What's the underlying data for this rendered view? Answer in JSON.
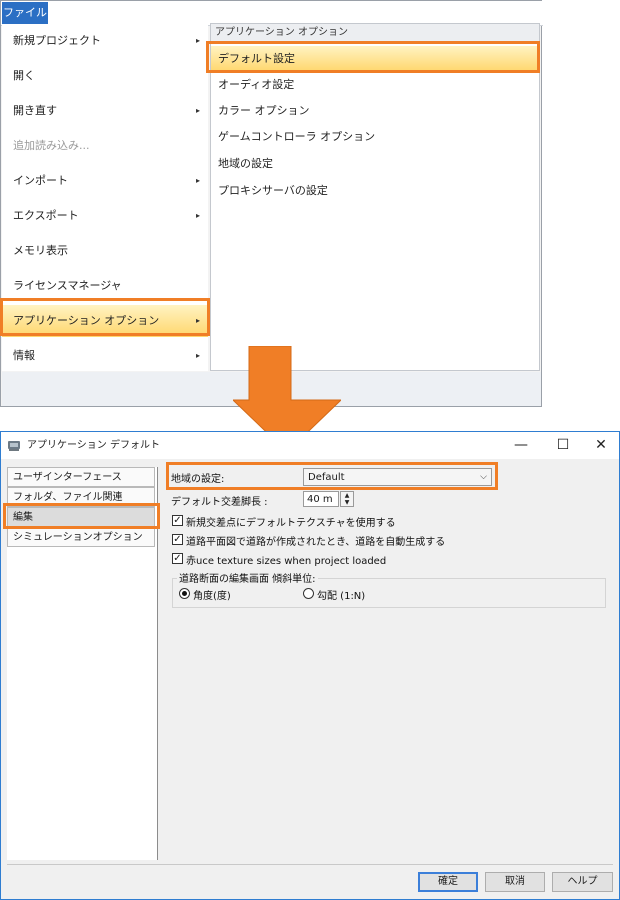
{
  "menu": {
    "file_tab": "ファイル",
    "items": [
      {
        "label": "新規プロジェクト",
        "arrow": true
      },
      {
        "label": "開く",
        "arrow": false
      },
      {
        "label": "開き直す",
        "arrow": true
      },
      {
        "label": "追加読み込み...",
        "arrow": false,
        "disabled": true
      },
      {
        "label": "インポート",
        "arrow": true
      },
      {
        "label": "エクスポート",
        "arrow": true
      },
      {
        "label": "メモリ表示",
        "arrow": false
      },
      {
        "label": "ライセンスマネージャ",
        "arrow": false
      },
      {
        "label": "アプリケーション オプション",
        "arrow": true,
        "selected": true
      },
      {
        "label": "情報",
        "arrow": true
      }
    ],
    "arrow_glyph": "▸",
    "submenu": {
      "header": "アプリケーション オプション",
      "items": [
        {
          "label": "デフォルト設定",
          "selected": true
        },
        {
          "label": "オーディオ設定"
        },
        {
          "label": "カラー オプション"
        },
        {
          "label": "ゲームコントローラ オプション"
        },
        {
          "label": "地域の設定"
        },
        {
          "label": "プロキシサーバの設定"
        }
      ]
    }
  },
  "dialog": {
    "title": "アプリケーション デフォルト",
    "controls": {
      "minimize": "—",
      "maximize": "☐",
      "close": "✕"
    },
    "nav": [
      "ユーザインターフェース",
      "フォルダ、ファイル関連",
      "編集",
      "シミュレーションオプション"
    ],
    "nav_selected": 2,
    "region_label": "地域の設定:",
    "region_value": "Default",
    "region_chevron": "⌵",
    "intersection_label": "デフォルト交差脚長 :",
    "intersection_value": "40 m",
    "stepper_up": "▲",
    "stepper_down": "▼",
    "checkboxes": [
      {
        "label": "新規交差点にデフォルトテクスチャを使用する",
        "checked": true
      },
      {
        "label": "道路平面図で道路が作成されたとき、道路を自動生成する",
        "checked": true
      },
      {
        "label": "赤uce texture sizes when project loaded",
        "checked": true
      }
    ],
    "check_glyph": "✓",
    "group_label": "道路断面の編集画面 傾斜単位:",
    "radios": [
      {
        "label": "角度(度)",
        "selected": true
      },
      {
        "label": "勾配 (1:N)",
        "selected": false
      }
    ],
    "buttons": {
      "ok": "確定",
      "cancel": "取消",
      "help": "ヘルプ"
    }
  },
  "colors": {
    "highlight": "#f07e26",
    "file_tab": "#2b6fc4",
    "selection_top": "#fff3c2",
    "selection_bottom": "#ffd66b",
    "arrow": "#f07e26"
  }
}
